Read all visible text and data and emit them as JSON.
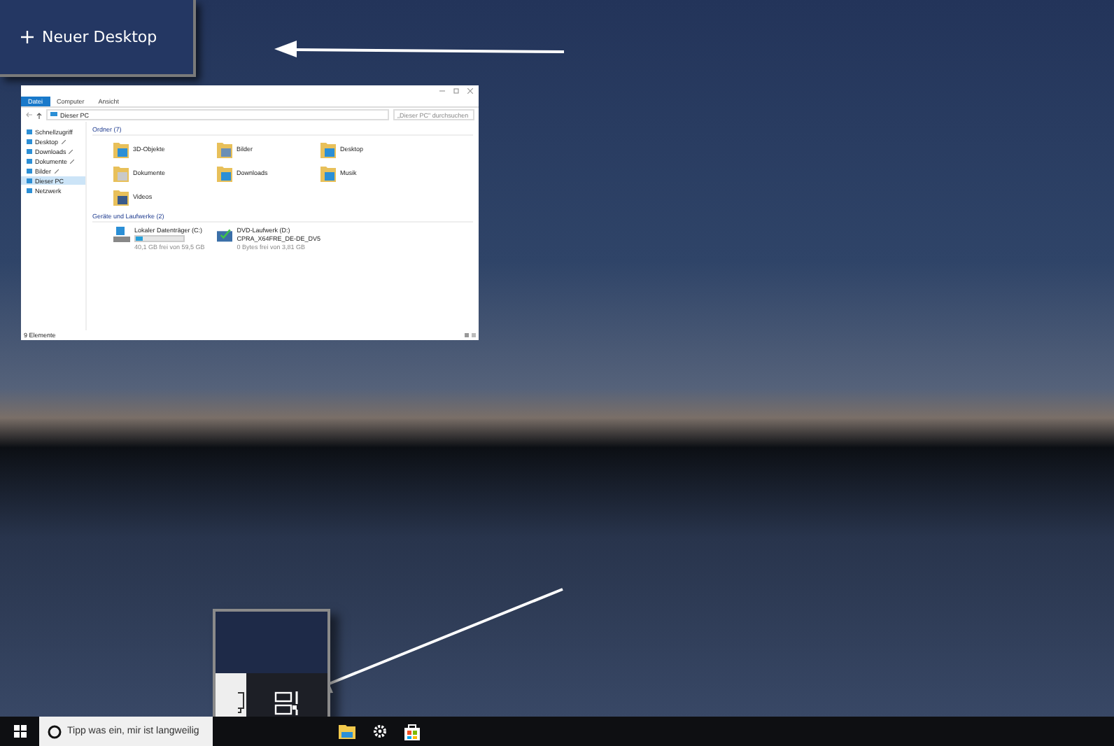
{
  "new_desktop": {
    "label": "Neuer Desktop"
  },
  "explorer": {
    "tabs": [
      {
        "label": "Datei",
        "selected": true
      },
      {
        "label": "Computer",
        "selected": false
      },
      {
        "label": "Ansicht",
        "selected": false
      }
    ],
    "address": "Dieser PC",
    "search": {
      "placeholder": "„Dieser PC\" durchsuchen"
    },
    "sidebar": [
      {
        "label": "Schnellzugriff",
        "pinned": false,
        "selected": false
      },
      {
        "label": "Desktop",
        "pinned": true,
        "selected": false
      },
      {
        "label": "Downloads",
        "pinned": true,
        "selected": false
      },
      {
        "label": "Dokumente",
        "pinned": true,
        "selected": false
      },
      {
        "label": "Bilder",
        "pinned": true,
        "selected": false
      },
      {
        "label": "Dieser PC",
        "pinned": false,
        "selected": true
      },
      {
        "label": "Netzwerk",
        "pinned": false,
        "selected": false
      }
    ],
    "folders_title": "Ordner (7)",
    "folders": [
      {
        "label": "3D-Objekte",
        "kind": "cube"
      },
      {
        "label": "Bilder",
        "kind": "pictures"
      },
      {
        "label": "Desktop",
        "kind": "desktop"
      },
      {
        "label": "Dokumente",
        "kind": "documents"
      },
      {
        "label": "Downloads",
        "kind": "downloads"
      },
      {
        "label": "Musik",
        "kind": "music"
      },
      {
        "label": "Videos",
        "kind": "videos"
      }
    ],
    "drives_title": "Geräte und Laufwerke (2)",
    "drives": [
      {
        "kind": "disk",
        "name": "Lokaler Datenträger (C:)",
        "level": 0.15,
        "free": "40,1 GB frei von 59,5 GB"
      },
      {
        "kind": "dvd",
        "name": "DVD-Laufwerk (D:)",
        "label": "CPRA_X64FRE_DE-DE_DV5",
        "free": "0 Bytes frei von 3,81 GB"
      }
    ],
    "status": "9 Elemente"
  },
  "taskbar": {
    "search": {
      "placeholder": "Tipp was ein, mir ist langweilig"
    }
  }
}
